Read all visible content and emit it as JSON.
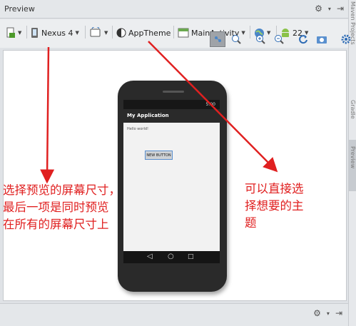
{
  "window": {
    "title": "Preview",
    "settings_glyph": "⚙",
    "menu_glyph": "▾",
    "pin_glyph": "⇥"
  },
  "side_strip": {
    "labels": [
      "Maven Projects",
      "Gradle",
      "Preview"
    ]
  },
  "toolbar": {
    "device": "Nexus 4",
    "theme": "AppTheme",
    "activity": "MainActivity",
    "api_level": "22"
  },
  "toolbar_row2": {
    "icons": [
      "layout-icon",
      "zoom-actual-icon",
      "zoom-in-icon",
      "zoom-out-icon",
      "refresh-icon",
      "screenshot-icon",
      "settings-icon"
    ]
  },
  "device_preview": {
    "status_text": "5:00",
    "app_title": "My Application",
    "hello_text": "Hello world!",
    "button_label": "NEW BUTTON"
  },
  "annotations": {
    "left_note": "选择预览的屏幕尺寸，\n最后一项是同时预览\n在所有的屏幕尺寸上",
    "right_note": "可以直接选\n择想要的主\n题",
    "color": "#e02020"
  }
}
